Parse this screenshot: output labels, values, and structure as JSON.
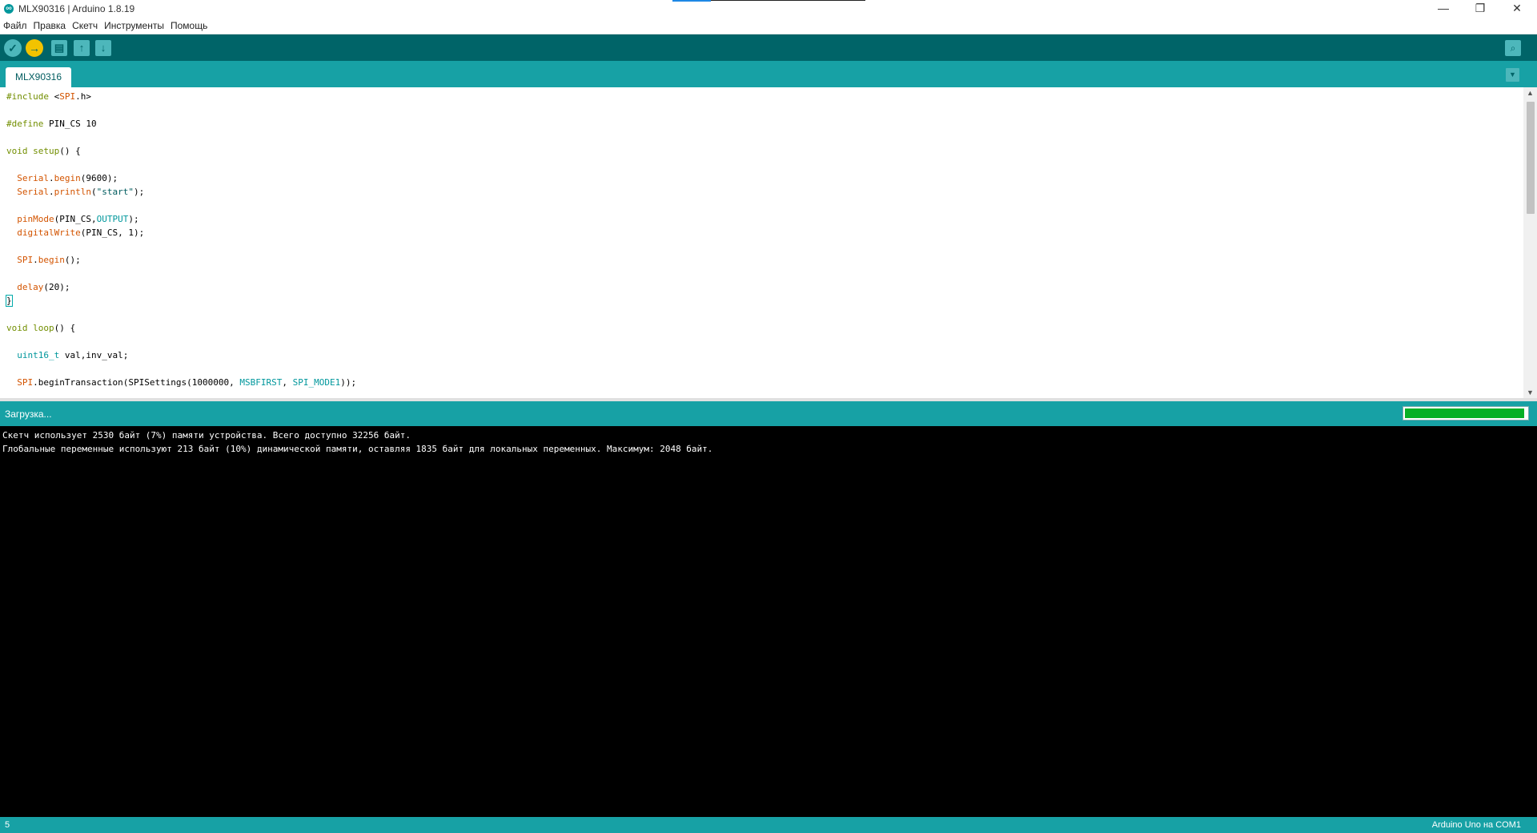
{
  "window": {
    "title": "MLX90316 | Arduino 1.8.19",
    "app_icon_label": "oo",
    "minimize": "—",
    "maximize": "❐",
    "close": "✕"
  },
  "menu": {
    "items": [
      "Файл",
      "Правка",
      "Скетч",
      "Инструменты",
      "Помощь"
    ]
  },
  "toolbar": {
    "verify_icon": "✓",
    "upload_icon": "→",
    "new_icon": "▤",
    "open_icon": "↑",
    "save_icon": "↓",
    "serial_icon": "⌕"
  },
  "tabs": {
    "active": "MLX90316",
    "menu_icon": "▼"
  },
  "editor": {
    "line_number": "5"
  },
  "status": {
    "message": "Загрузка...",
    "progress_fraction": 0.98,
    "progress_color": "#06b025"
  },
  "console": {
    "lines": [
      "Скетч использует 2530 байт (7%) памяти устройства. Всего доступно 32256 байт.",
      "Глобальные переменные используют 213 байт (10%) динамической памяти, оставляя 1835 байт для локальных переменных. Максимум: 2048 байт."
    ]
  },
  "bottom": {
    "board": "Arduino Uno на COM1"
  },
  "colors": {
    "toolbar": "#006468",
    "accent": "#17a1a5",
    "keyword": "#728e00",
    "function": "#d35400",
    "constant": "#00979c"
  }
}
